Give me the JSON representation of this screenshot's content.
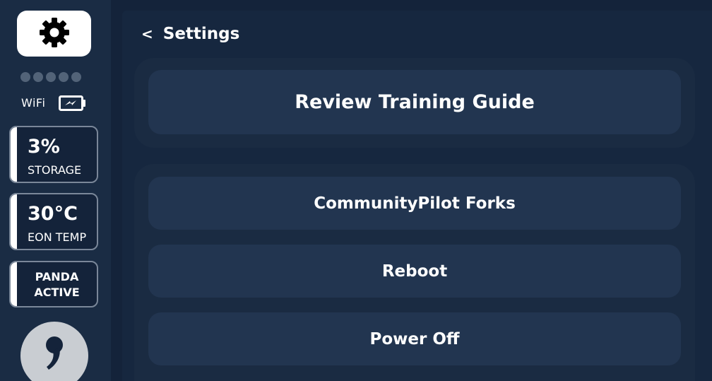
{
  "sidebar": {
    "settings_icon": "gear-icon",
    "signal_dots": 5,
    "wifi_label": "WiFi",
    "battery_icon": "battery-charging-icon",
    "storage": {
      "value": "3%",
      "label": "STORAGE"
    },
    "temp": {
      "value": "30°C",
      "label": "EON TEMP"
    },
    "panda": {
      "line1": "PANDA",
      "line2": "ACTIVE"
    },
    "logo_icon": "comma-logo-icon"
  },
  "header": {
    "back_symbol": "<",
    "title": "Settings"
  },
  "buttons": {
    "review_training_guide": "Review Training Guide",
    "community_pilot_forks": "CommunityPilot Forks",
    "reboot": "Reboot",
    "power_off": "Power Off"
  },
  "colors": {
    "background": "#14233a",
    "sidebar": "#1a2c44",
    "button": "#223550",
    "status_bar": "#ffffff"
  }
}
